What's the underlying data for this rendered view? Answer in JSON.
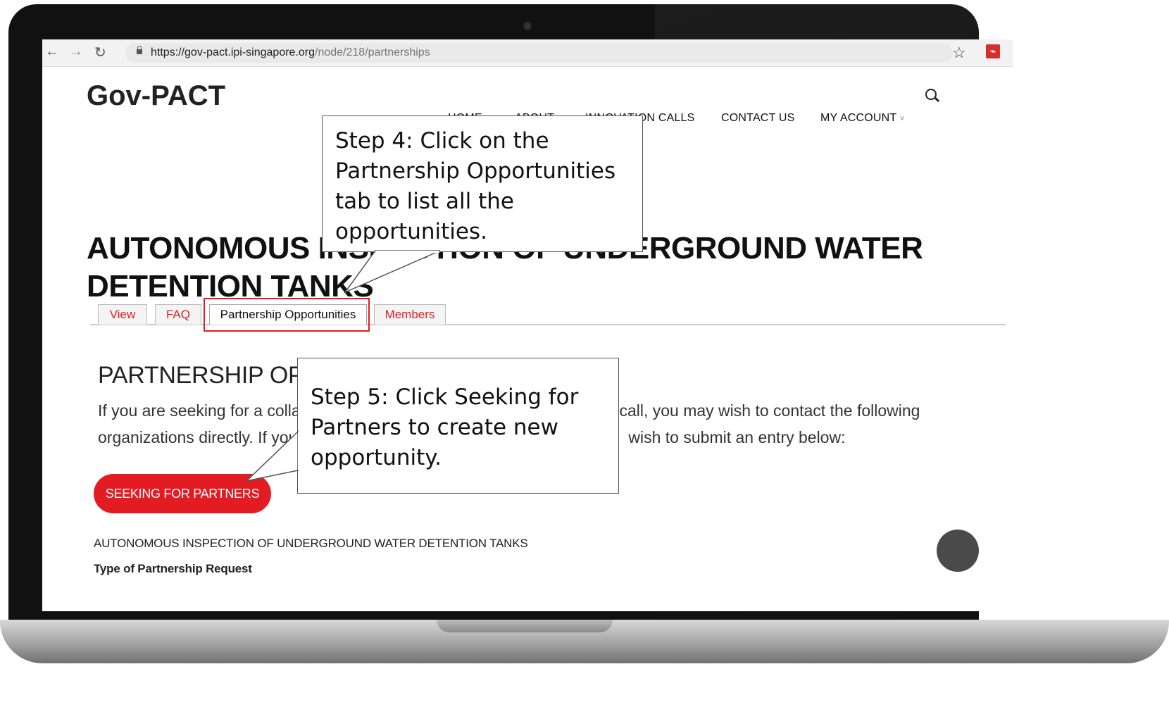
{
  "browser": {
    "url_host": "https://gov-pact.ipi-singapore.org",
    "url_path": "/node/218/partnerships",
    "back_icon": "back-arrow-icon",
    "forward_icon": "forward-arrow-icon",
    "reload_icon": "reload-icon",
    "bookmark_icon": "star-icon"
  },
  "site": {
    "title": "Gov-PACT",
    "menu": [
      "HOME",
      "ABOUT",
      "INNOVATION CALLS",
      "CONTACT US",
      "MY ACCOUNT"
    ],
    "search_icon": "search-icon"
  },
  "page": {
    "heading": "AUTONOMOUS INSPECTION OF UNDERGROUND WATER DETENTION TANKS",
    "tabs": [
      "View",
      "FAQ",
      "Partnership Opportunities",
      "Members"
    ],
    "active_tab": "Partnership Opportunities",
    "section_heading": "PARTNERSHIP OPPORTUNITIES",
    "intro_line1_left": "If you are seeking for a collab",
    "intro_line1_right": "call, you may wish to contact the following",
    "intro_line2_left": "organizations directly. If you",
    "intro_line2_right": "wish to submit an entry below:",
    "button_label": "SEEKING FOR PARTNERS",
    "item_title": "AUTONOMOUS INSPECTION OF UNDERGROUND WATER DETENTION TANKS",
    "item_label": "Type of Partnership Request"
  },
  "callouts": {
    "step4": "Step 4: Click on the Partnership Opportunities tab to list all the opportunities.",
    "step5": "Step 5: Click Seeking for Partners to create new opportunity."
  },
  "colors": {
    "accent": "#e31b23",
    "text": "#222222"
  }
}
